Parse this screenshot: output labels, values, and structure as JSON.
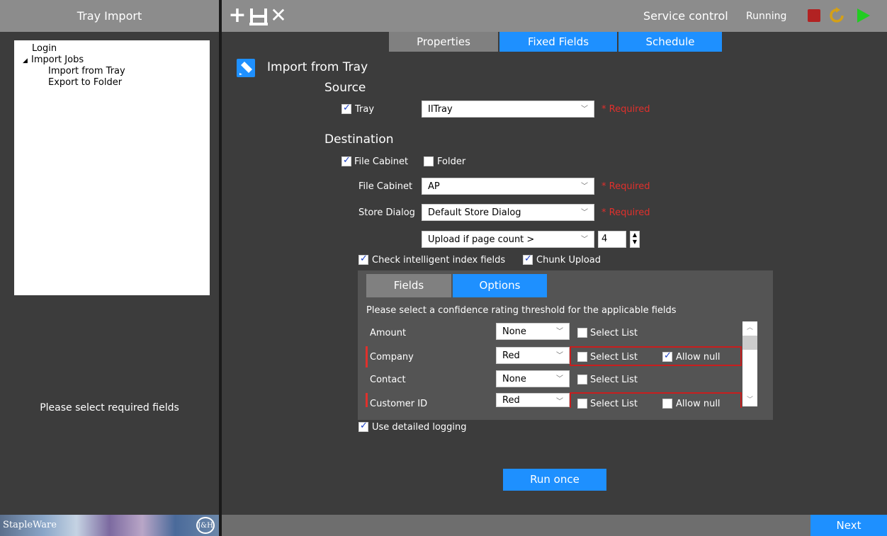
{
  "left_panel": {
    "title": "Tray Import",
    "tree": [
      {
        "label": "Login"
      },
      {
        "label": "Import Jobs",
        "arrow": "◢"
      },
      {
        "label": "Import from Tray"
      },
      {
        "label": "Export to Folder"
      }
    ],
    "status": "Please select required fields",
    "logo_left": "StapleWare",
    "logo_right": "J&H"
  },
  "toolbar": {
    "add_icon": "plus-icon",
    "save_icon": "save-icon",
    "close_icon": "close-icon",
    "add_glyph": "+",
    "close_glyph": "✕",
    "service_label": "Service control",
    "service_status": "Running",
    "colors": {
      "stop": "#b22222",
      "restart": "#d4a017",
      "play": "#22cc22"
    }
  },
  "tabs": [
    {
      "label": "Properties",
      "active": false
    },
    {
      "label": "Fixed Fields",
      "active": true
    },
    {
      "label": "Schedule",
      "active": true
    }
  ],
  "job": {
    "title": "Import from Tray",
    "source": {
      "heading": "Source",
      "tray_checkbox_label": "Tray",
      "tray_checked": true,
      "tray_value": "IITray",
      "required": "* Required"
    },
    "destination": {
      "heading": "Destination",
      "file_cabinet_checkbox_label": "File Cabinet",
      "file_cabinet_checked": true,
      "folder_checkbox_label": "Folder",
      "folder_checked": false,
      "file_cabinet_label": "File Cabinet",
      "file_cabinet_value": "AP",
      "store_dialog_label": "Store Dialog",
      "store_dialog_value": "Default Store Dialog",
      "required": "* Required",
      "upload_value": "Upload if page count >",
      "upload_count": "4",
      "check_intelligent_label": "Check intelligent index fields",
      "check_intelligent_checked": true,
      "chunk_upload_label": "Chunk Upload",
      "chunk_upload_checked": true
    },
    "fields_panel": {
      "tabs": [
        {
          "label": "Fields",
          "active": false
        },
        {
          "label": "Options",
          "active": true
        }
      ],
      "hint": "Please select a confidence rating threshold for the applicable fields",
      "select_list_label": "Select List",
      "allow_null_label": "Allow null",
      "rows": [
        {
          "name": "Amount",
          "threshold": "None",
          "select_list": false,
          "required": false
        },
        {
          "name": "Company",
          "threshold": "Red",
          "select_list": false,
          "required": true,
          "allow_null": true
        },
        {
          "name": "Contact",
          "threshold": "None",
          "select_list": false,
          "required": false
        },
        {
          "name": "Customer ID",
          "threshold": "Red",
          "select_list": false,
          "required": true,
          "allow_null": false
        }
      ]
    },
    "detailed_logging_label": "Use detailed logging",
    "detailed_logging_checked": true,
    "run_once_label": "Run once"
  },
  "footer": {
    "next_label": "Next"
  },
  "colors": {
    "accent": "#1e90ff",
    "required": "#e0302c",
    "tab_inactive": "#808080"
  }
}
